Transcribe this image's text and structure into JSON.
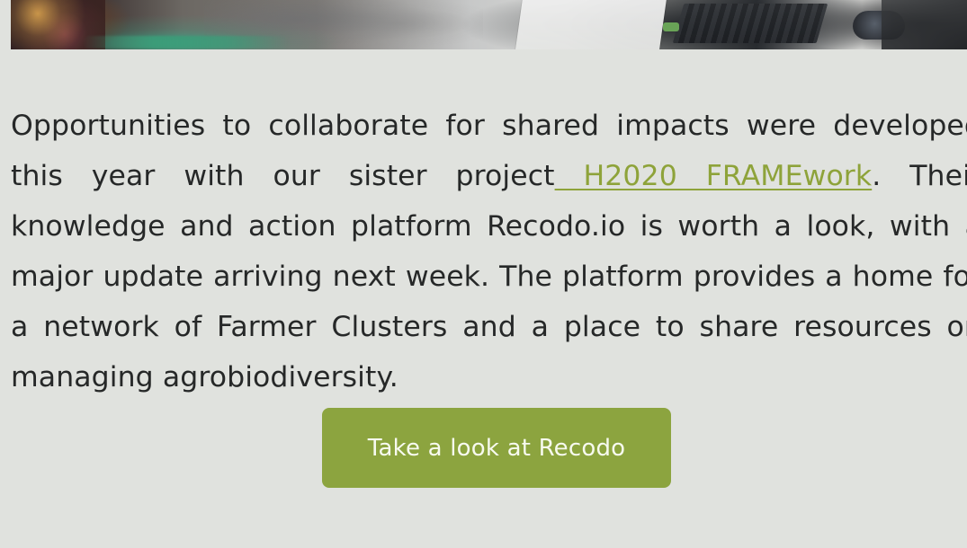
{
  "page": {
    "body": {
      "text_before_link": "Opportunities to collaborate for shared impacts were developed this year with our sister project",
      "link_label": " H2020 FRAMEwork",
      "text_after_link": ". Their knowledge and action platform Recodo.io is worth a look, with a major update arriving next week. The platform provides a home for a network of Farmer Clusters and a place to share resources on managing agrobiodiversity."
    },
    "cta": {
      "label": "Take a look at Recodo"
    },
    "colors": {
      "background": "#e0e2de",
      "text": "#262828",
      "link": "#8ea33a",
      "button": "#8ca43f",
      "button_text": "#f7faef"
    }
  }
}
